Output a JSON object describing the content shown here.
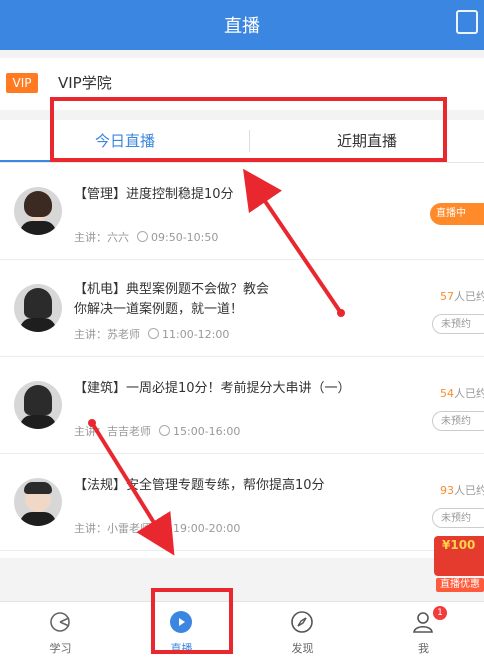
{
  "header": {
    "title": "直播"
  },
  "vip": {
    "badge": "VIP",
    "label": "VIP学院"
  },
  "tabs": {
    "today": "今日直播",
    "recent": "近期直播"
  },
  "items": [
    {
      "title": "【管理】进度控制稳提10分",
      "teacher": "主讲：六六",
      "time": "09:50-10:50",
      "action": "直播中"
    },
    {
      "title": "【机电】典型案例题不会做？教会",
      "title2": "你解决一道案例题，就一道！",
      "teacher": "主讲：苏老师",
      "time": "11:00-12:00",
      "count_num": "57",
      "count_suffix": "人已约",
      "action": "未预约"
    },
    {
      "title": "【建筑】一周必提10分！考前提分大串讲（一）",
      "teacher": "主讲：吉吉老师",
      "time": "15:00-16:00",
      "count_num": "54",
      "count_suffix": "人已约",
      "action": "未预约"
    },
    {
      "title": "【法规】安全管理专题专练，帮你提高10分",
      "teacher": "主讲：小雷老师",
      "time": "19:00-20:00",
      "count_num": "93",
      "count_suffix": "人已约",
      "action": "未预约"
    }
  ],
  "promo": {
    "amount": "¥100",
    "label": "直播优惠"
  },
  "tabbar": [
    {
      "label": "学习",
      "icon": "study-icon"
    },
    {
      "label": "直播",
      "icon": "play-icon"
    },
    {
      "label": "发现",
      "icon": "compass-icon"
    },
    {
      "label": "我",
      "icon": "user-icon",
      "badge": "1"
    }
  ],
  "colors": {
    "accent": "#3b86e0",
    "orange": "#ff8a2a",
    "annotation": "#e8272f"
  }
}
